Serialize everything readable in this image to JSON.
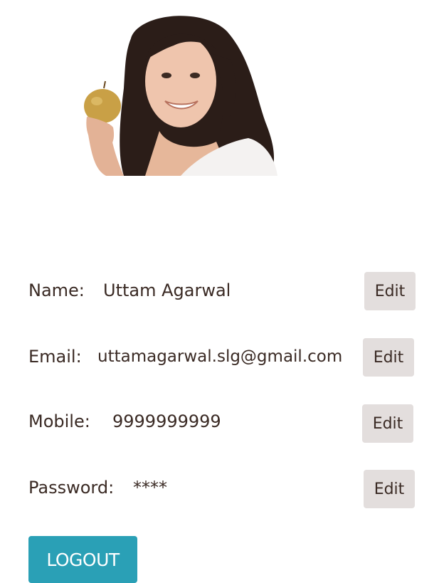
{
  "profile": {
    "photo_icon": "profile-photo",
    "fields": [
      {
        "label": "Name:",
        "value": "Uttam Agarwal",
        "edit_label": "Edit"
      },
      {
        "label": "Email:",
        "value": "uttamagarwal.slg@gmail.com",
        "edit_label": "Edit"
      },
      {
        "label": "Mobile:",
        "value": "9999999999",
        "edit_label": "Edit"
      },
      {
        "label": "Password:",
        "value": "****",
        "edit_label": "Edit"
      }
    ]
  },
  "actions": {
    "logout_label": "LOGOUT"
  },
  "colors": {
    "text": "#3a2a24",
    "edit_button_bg": "#e3dedd",
    "logout_button_bg": "#2aa0b6",
    "logout_button_text": "#ffffff"
  }
}
